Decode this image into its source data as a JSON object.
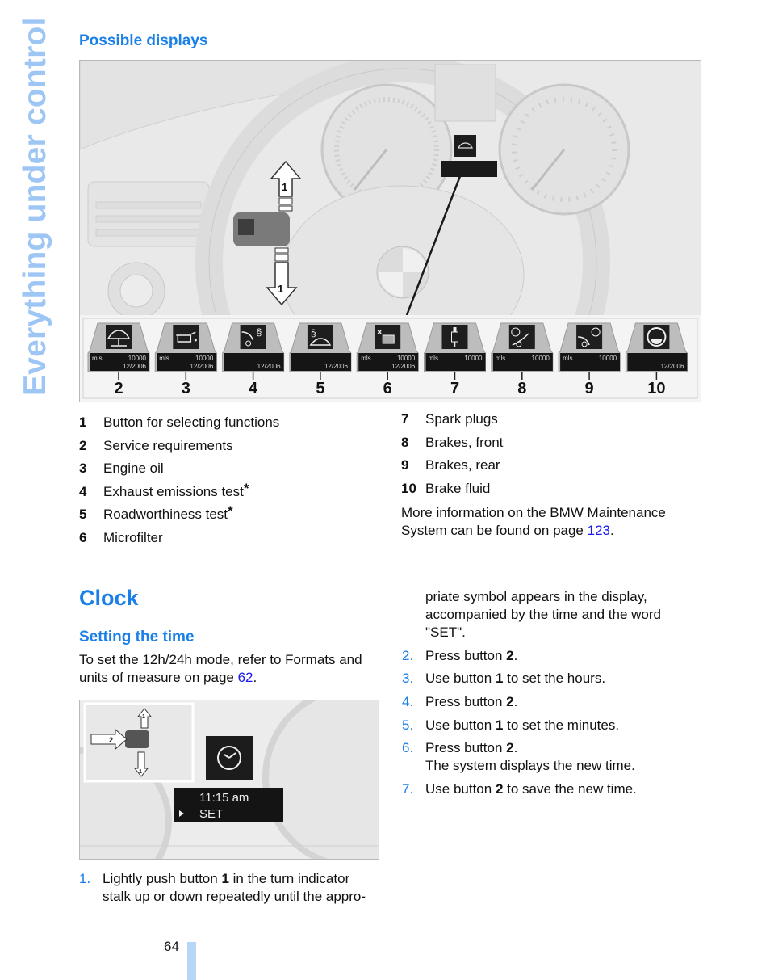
{
  "side_title": "Everything under control",
  "possible_displays": {
    "heading": "Possible displays",
    "figure": {
      "dashboard_callouts": [
        "1",
        "1"
      ],
      "tiles": [
        {
          "label": "2",
          "icon": "service-lift-car-icon",
          "row1_unit": "mls",
          "row1_value": "10000",
          "row2_value": "12/2006"
        },
        {
          "label": "3",
          "icon": "oil-can-icon",
          "row1_unit": "mls",
          "row1_value": "10000",
          "row2_value": "12/2006"
        },
        {
          "label": "4",
          "icon": "exhaust-test-icon",
          "row1_unit": "",
          "row1_value": "",
          "row2_value": "12/2006"
        },
        {
          "label": "5",
          "icon": "roadworthiness-car-icon",
          "row1_unit": "",
          "row1_value": "",
          "row2_value": "12/2006"
        },
        {
          "label": "6",
          "icon": "microfilter-fan-icon",
          "row1_unit": "mls",
          "row1_value": "10000",
          "row2_value": "12/2006"
        },
        {
          "label": "7",
          "icon": "spark-plug-icon",
          "row1_unit": "mls",
          "row1_value": "10000",
          "row2_value": ""
        },
        {
          "label": "8",
          "icon": "front-brake-icon",
          "row1_unit": "mls",
          "row1_value": "10000",
          "row2_value": ""
        },
        {
          "label": "9",
          "icon": "rear-brake-icon",
          "row1_unit": "mls",
          "row1_value": "10000",
          "row2_value": ""
        },
        {
          "label": "10",
          "icon": "brake-fluid-icon",
          "row1_unit": "",
          "row1_value": "",
          "row2_value": "12/2006"
        }
      ]
    },
    "legend_left": [
      {
        "num": "1",
        "text": "Button for selecting functions",
        "star": ""
      },
      {
        "num": "2",
        "text": "Service requirements",
        "star": ""
      },
      {
        "num": "3",
        "text": "Engine oil",
        "star": ""
      },
      {
        "num": "4",
        "text": "Exhaust emissions test",
        "star": "*"
      },
      {
        "num": "5",
        "text": "Roadworthiness test",
        "star": "*"
      },
      {
        "num": "6",
        "text": "Microfilter",
        "star": ""
      }
    ],
    "legend_right": [
      {
        "num": "7",
        "text": "Spark plugs"
      },
      {
        "num": "8",
        "text": "Brakes, front"
      },
      {
        "num": "9",
        "text": "Brakes, rear"
      },
      {
        "num": "10",
        "text": "Brake fluid"
      }
    ],
    "more_info": {
      "line1": "More information on the BMW Maintenance",
      "line2_pre": "System can be found on page ",
      "link": "123",
      "line2_post": "."
    }
  },
  "clock": {
    "heading": "Clock",
    "subheading": "Setting the time",
    "intro_line1": "To set the 12h/24h mode, refer to Formats and",
    "intro_line2_pre": "units of measure on page ",
    "intro_link": "62",
    "intro_line2_post": ".",
    "figure": {
      "time_display": "11:15 am",
      "set_label": "SET",
      "callout_2": "2",
      "callout_1_up": "1",
      "callout_1_down": "1"
    },
    "steps": [
      {
        "num": "1.",
        "lines": [
          [
            "Lightly push button ",
            "1",
            " in the turn indicator"
          ],
          [
            "stalk up or down repeatedly until the appro-",
            "",
            ""
          ]
        ]
      },
      {
        "num": "",
        "lines": [
          [
            "priate symbol appears in the display,",
            "",
            ""
          ],
          [
            "accompanied by the time and the word",
            "",
            ""
          ],
          [
            "\"SET\".",
            "",
            ""
          ]
        ]
      },
      {
        "num": "2.",
        "lines": [
          [
            "Press button ",
            "2",
            "."
          ]
        ]
      },
      {
        "num": "3.",
        "lines": [
          [
            "Use button ",
            "1",
            " to set the hours."
          ]
        ]
      },
      {
        "num": "4.",
        "lines": [
          [
            "Press button ",
            "2",
            "."
          ]
        ]
      },
      {
        "num": "5.",
        "lines": [
          [
            "Use button ",
            "1",
            " to set the minutes."
          ]
        ]
      },
      {
        "num": "6.",
        "lines": [
          [
            "Press button ",
            "2",
            "."
          ],
          [
            "The system displays the new time.",
            "",
            ""
          ]
        ]
      },
      {
        "num": "7.",
        "lines": [
          [
            "Use button ",
            "2",
            " to save the new time."
          ]
        ]
      }
    ]
  },
  "footer": {
    "page_number": "64"
  }
}
